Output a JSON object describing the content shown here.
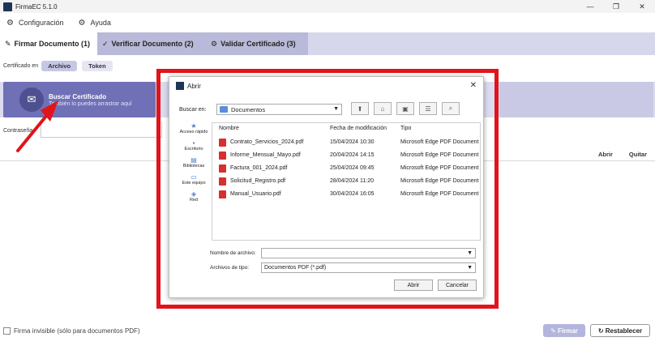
{
  "window": {
    "title": "FirmaEC 5.1.0",
    "minimize": "—",
    "maximize": "❐",
    "close": "✕"
  },
  "menu": {
    "items": [
      {
        "label": "Configuración",
        "icon": "gear-icon"
      },
      {
        "label": "Ayuda",
        "icon": "help-icon"
      }
    ]
  },
  "tabs": [
    {
      "label": "Firmar Documento (1)",
      "active": true
    },
    {
      "label": "Verificar Documento (2)",
      "active": false
    },
    {
      "label": "Validar Certificado (3)",
      "active": false
    }
  ],
  "certificate": {
    "label": "Certificado en",
    "options": [
      "Archivo",
      "Token"
    ],
    "selected": "Archivo"
  },
  "dropzone": {
    "title": "Buscar Certificado",
    "subtitle": "También lo puedes arrastrar aquí"
  },
  "password": {
    "label": "Contraseña"
  },
  "documents_list": {
    "columns": [
      "Abrir",
      "Quitar"
    ]
  },
  "footer": {
    "invisible_signature_label": "Firma invisible (sólo para documentos PDF)",
    "sign_button": "Firmar",
    "reset_button": "Restablecer"
  },
  "dialog": {
    "title": "Abrir",
    "look_in_label": "Buscar en:",
    "look_in_value": "Documentos",
    "places": [
      {
        "label": "Acceso rápido",
        "icon": "star-icon"
      },
      {
        "label": "Escritorio",
        "icon": "desktop-icon"
      },
      {
        "label": "Bibliotecas",
        "icon": "library-icon"
      },
      {
        "label": "Este equipo",
        "icon": "computer-icon"
      },
      {
        "label": "Red",
        "icon": "network-icon"
      }
    ],
    "columns": {
      "name": "Nombre",
      "modified": "Fecha de modificación",
      "type": "Tipo"
    },
    "files": [
      {
        "name": "Contrato_Servicios_2024.pdf",
        "modified": "15/04/2024 10:30",
        "type": "Microsoft Edge PDF Document"
      },
      {
        "name": "Informe_Mensual_Mayo.pdf",
        "modified": "20/04/2024 14:15",
        "type": "Microsoft Edge PDF Document"
      },
      {
        "name": "Factura_001_2024.pdf",
        "modified": "25/04/2024 09:45",
        "type": "Microsoft Edge PDF Document"
      },
      {
        "name": "Solicitud_Registro.pdf",
        "modified": "28/04/2024 11:20",
        "type": "Microsoft Edge PDF Document"
      },
      {
        "name": "Manual_Usuario.pdf",
        "modified": "30/04/2024 16:05",
        "type": "Microsoft Edge PDF Document"
      }
    ],
    "file_name_label": "Nombre de archivo:",
    "file_name_value": "",
    "file_type_label": "Archivos de tipo:",
    "file_type_value": "Documentos PDF (*.pdf)",
    "open_button": "Abrir",
    "cancel_button": "Cancelar"
  },
  "colors": {
    "accent": "#6f70b6",
    "tab_inactive": "#b9b9d9",
    "highlight": "#e0141b"
  }
}
